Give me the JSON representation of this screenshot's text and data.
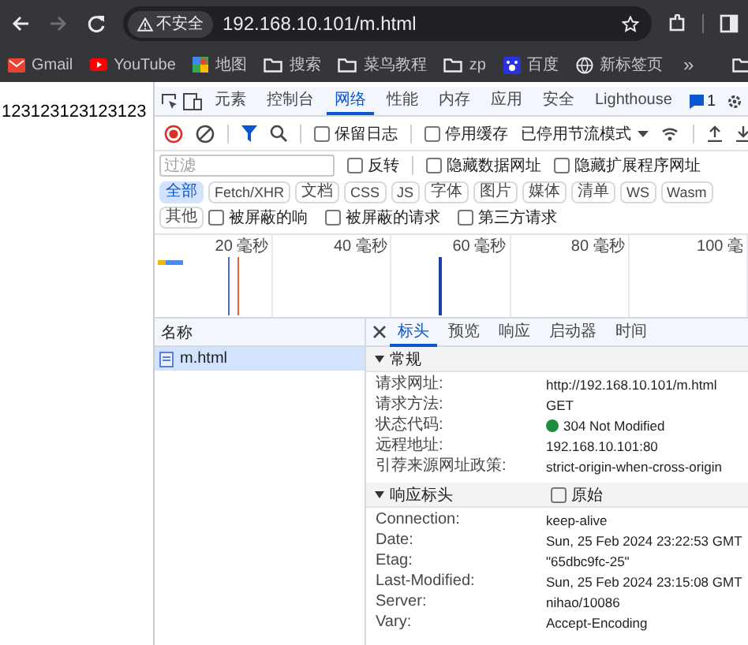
{
  "browser": {
    "nav": [
      {
        "kind": "back",
        "disabled": false
      },
      {
        "kind": "forward",
        "disabled": true
      },
      {
        "kind": "reload",
        "disabled": false
      }
    ],
    "address": {
      "security_label": "不安全",
      "url": "192.168.10.101/m.html"
    },
    "bookmarks": [
      {
        "kind": "gmail",
        "label": "Gmail"
      },
      {
        "kind": "youtube",
        "label": "YouTube"
      },
      {
        "kind": "maps",
        "label": "地图"
      },
      {
        "kind": "folder",
        "label": "搜索"
      },
      {
        "kind": "folder",
        "label": "菜鸟教程"
      },
      {
        "kind": "folder",
        "label": "zp"
      },
      {
        "kind": "baidu",
        "label": "百度"
      },
      {
        "kind": "globe",
        "label": "新标签页"
      }
    ],
    "more_bookmarks": "»"
  },
  "page": {
    "text": "123123123123123"
  },
  "devtools": {
    "tabs": [
      {
        "label": "元素",
        "selected": false
      },
      {
        "label": "控制台",
        "selected": false
      },
      {
        "label": "网络",
        "selected": true
      },
      {
        "label": "性能",
        "selected": false
      },
      {
        "label": "内存",
        "selected": false
      },
      {
        "label": "应用",
        "selected": false
      },
      {
        "label": "安全",
        "selected": false
      },
      {
        "label": "Lighthouse",
        "selected": false
      }
    ],
    "issues_badge": "1",
    "toolbar": {
      "recording": true,
      "checkboxes": [
        {
          "label": "保留日志",
          "checked": false
        },
        {
          "label": "停用缓存",
          "checked": false
        }
      ],
      "throttling": "已停用节流模式"
    },
    "filter": {
      "placeholder": "过滤",
      "options": [
        {
          "label": "反转",
          "checked": false
        },
        {
          "label": "隐藏数据网址",
          "checked": false
        },
        {
          "label": "隐藏扩展程序网址",
          "checked": false
        }
      ]
    },
    "types": [
      {
        "label": "全部",
        "selected": true
      },
      {
        "label": "Fetch/XHR",
        "selected": false
      },
      {
        "label": "文档",
        "selected": false
      },
      {
        "label": "CSS",
        "selected": false
      },
      {
        "label": "JS",
        "selected": false
      },
      {
        "label": "字体",
        "selected": false
      },
      {
        "label": "图片",
        "selected": false
      },
      {
        "label": "媒体",
        "selected": false
      },
      {
        "label": "清单",
        "selected": false
      },
      {
        "label": "WS",
        "selected": false
      },
      {
        "label": "Wasm",
        "selected": false
      },
      {
        "label": "其他",
        "selected": false
      }
    ],
    "extra_filters": [
      {
        "label": "被屏蔽的响",
        "checked": false
      },
      {
        "label": "被屏蔽的请求",
        "checked": false
      },
      {
        "label": "第三方请求",
        "checked": false
      }
    ],
    "timeline": {
      "ticks": [
        "20 毫秒",
        "40 毫秒",
        "60 毫秒",
        "80 毫秒",
        "100 毫"
      ]
    },
    "requests": {
      "column": "名称",
      "items": [
        {
          "name": "m.html",
          "selected": true
        }
      ]
    },
    "detail_tabs": [
      {
        "label": "标头",
        "selected": true
      },
      {
        "label": "预览",
        "selected": false
      },
      {
        "label": "响应",
        "selected": false
      },
      {
        "label": "启动器",
        "selected": false
      },
      {
        "label": "时间",
        "selected": false
      }
    ],
    "sections": [
      {
        "title": "常规",
        "expanded": true,
        "rows": [
          {
            "name": "请求网址:",
            "value": "http://192.168.10.101/m.html"
          },
          {
            "name": "请求方法:",
            "value": "GET"
          },
          {
            "name": "状态代码:",
            "value": "304 Not Modified",
            "color": "#1e8e3e"
          },
          {
            "name": "远程地址:",
            "value": "192.168.10.101:80"
          },
          {
            "name": "引荐来源网址政策:",
            "value": "strict-origin-when-cross-origin"
          }
        ]
      },
      {
        "title": "响应标头",
        "expanded": true,
        "raw_option": {
          "label": "原始",
          "checked": false
        },
        "rows": [
          {
            "name": "Connection:",
            "value": "keep-alive"
          },
          {
            "name": "Date:",
            "value": "Sun, 25 Feb 2024 23:22:53 GMT"
          },
          {
            "name": "Etag:",
            "value": "\"65dbc9fc-25\""
          },
          {
            "name": "Last-Modified:",
            "value": "Sun, 25 Feb 2024 23:15:08 GMT"
          },
          {
            "name": "Server:",
            "value": "nihao/10086"
          },
          {
            "name": "Vary:",
            "value": "Accept-Encoding"
          }
        ]
      }
    ]
  }
}
